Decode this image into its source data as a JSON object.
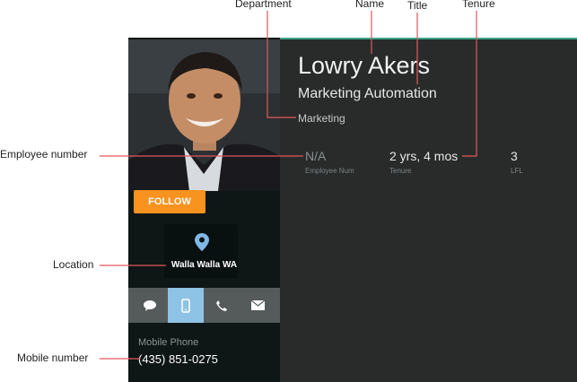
{
  "callouts": {
    "department": "Department",
    "name": "Name",
    "title": "Title",
    "tenure": "Tenure",
    "employee_number": "Employee number",
    "location": "Location",
    "mobile_number": "Mobile number"
  },
  "profile": {
    "name": "Lowry Akers",
    "title": "Marketing Automation",
    "department": "Marketing",
    "follow_label": "FOLLOW",
    "location": "Walla Walla WA",
    "stats": [
      {
        "value": "N/A",
        "label": "Employee Num"
      },
      {
        "value": "2 yrs, 4 mos",
        "label": "Tenure"
      },
      {
        "value": "3",
        "label": "LFL"
      }
    ],
    "contact_buttons": [
      "chat-icon",
      "mobile-icon",
      "phone-icon",
      "mail-icon"
    ],
    "active_contact": "mobile-icon",
    "mobile_label": "Mobile Phone",
    "mobile_number": "(435) 851-0275"
  },
  "colors": {
    "accent_orange": "#f7931e",
    "active_blue": "#8fc3e6",
    "leader_line": "#e2585a",
    "panel_dark": "#292b2b"
  }
}
